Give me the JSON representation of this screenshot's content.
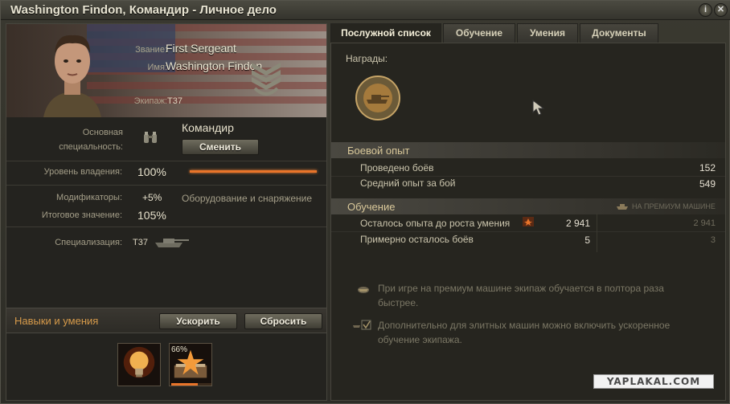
{
  "window": {
    "title": "Washington Findon, Командир - Личное дело",
    "help_icon": "info-icon",
    "close_icon": "close-icon"
  },
  "profile": {
    "rank_label": "Звание:",
    "rank_value": "First Sergeant",
    "name_label": "Имя:",
    "name_value": "Washington Findon",
    "crew_label": "Экипаж:",
    "crew_value": "T37"
  },
  "specialty": {
    "label": "Основная специальность:",
    "value": "Командир",
    "change_button": "Сменить",
    "icon": "binoculars-icon"
  },
  "mastery": {
    "label": "Уровень владения:",
    "value": "100%",
    "progress": 1.0
  },
  "modifiers": {
    "label": "Модификаторы:",
    "value": "+5%",
    "note": "Оборудование и снаряжение"
  },
  "total": {
    "label": "Итоговое значение:",
    "value": "105%"
  },
  "specialization": {
    "label": "Специализация:",
    "value": "T37",
    "icon": "tank-icon"
  },
  "skills": {
    "header": "Навыки и умения",
    "accelerate_button": "Ускорить",
    "reset_button": "Сбросить",
    "items": [
      {
        "name": "bulb-skill-icon",
        "progress": 1.0
      },
      {
        "name": "star-book-skill-icon",
        "percent_label": "66%",
        "progress": 0.66
      }
    ]
  },
  "tabs": [
    {
      "label": "Послужной список",
      "active": true
    },
    {
      "label": "Обучение",
      "active": false
    },
    {
      "label": "Умения",
      "active": false
    },
    {
      "label": "Документы",
      "active": false
    }
  ],
  "awards": {
    "label": "Награды:",
    "icon": "tank-medal-icon"
  },
  "combat": {
    "title": "Боевой опыт",
    "battles_label": "Проведено боёв",
    "battles_value": "152",
    "avg_xp_label": "Средний опыт за бой",
    "avg_xp_value": "549"
  },
  "training": {
    "title": "Обучение",
    "premium_label": "НА ПРЕМИУМ МАШИНЕ",
    "xp_left_label": "Осталось опыта до роста умения",
    "xp_left_value": "2 941",
    "xp_left_premium": "2 941",
    "battles_left_label": "Примерно осталось боёв",
    "battles_left_value": "5",
    "battles_left_premium": "3"
  },
  "notes": {
    "premium_note": "При игре на премиум машине экипаж обучается в полтора раза быстрее.",
    "elite_note": "Дополнительно для элитных машин можно включить ускоренное обучение экипажа."
  },
  "watermark": "YAPLAKAL.COM",
  "colors": {
    "accent_orange": "#e8742a",
    "section_title": "#d9c89a"
  }
}
